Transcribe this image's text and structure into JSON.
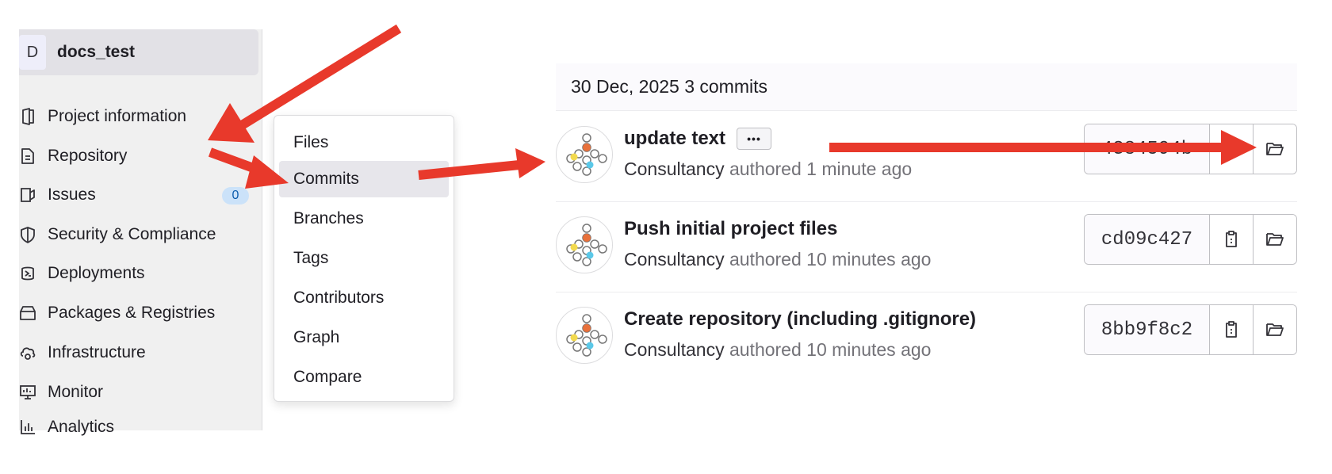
{
  "sidebar": {
    "project": {
      "initial": "D",
      "name": "docs_test"
    },
    "items": [
      {
        "label": "Project information",
        "icon": "project-info-icon"
      },
      {
        "label": "Repository",
        "icon": "document-icon"
      },
      {
        "label": "Issues",
        "icon": "issues-icon",
        "badge": "0"
      },
      {
        "label": "Security & Compliance",
        "icon": "shield-icon"
      },
      {
        "label": "Deployments",
        "icon": "deployments-icon"
      },
      {
        "label": "Packages & Registries",
        "icon": "package-icon"
      },
      {
        "label": "Infrastructure",
        "icon": "cloud-gear-icon"
      },
      {
        "label": "Monitor",
        "icon": "monitor-icon"
      },
      {
        "label": "Analytics",
        "icon": "chart-icon"
      }
    ]
  },
  "submenu": {
    "items": [
      "Files",
      "Commits",
      "Branches",
      "Tags",
      "Contributors",
      "Graph",
      "Compare"
    ],
    "active": "Commits"
  },
  "commits": {
    "day_header": "30 Dec, 2025 3 commits",
    "list": [
      {
        "title": "update text",
        "author": "Consultancy",
        "verb": "authored",
        "time": "1 minute ago",
        "sha": "4384594b",
        "has_ellipsis": true
      },
      {
        "title": "Push initial project files",
        "author": "Consultancy",
        "verb": "authored",
        "time": "10 minutes ago",
        "sha": "cd09c427"
      },
      {
        "title": "Create repository (including .gitignore)",
        "author": "Consultancy",
        "verb": "authored",
        "time": "10 minutes ago",
        "sha": "8bb9f8c2"
      }
    ],
    "ellipsis_label": "•••"
  },
  "colors": {
    "annotation_arrow": "#e8392b",
    "badge_bg": "#cbe2f9",
    "sidebar_bg": "#f0f0f0"
  }
}
